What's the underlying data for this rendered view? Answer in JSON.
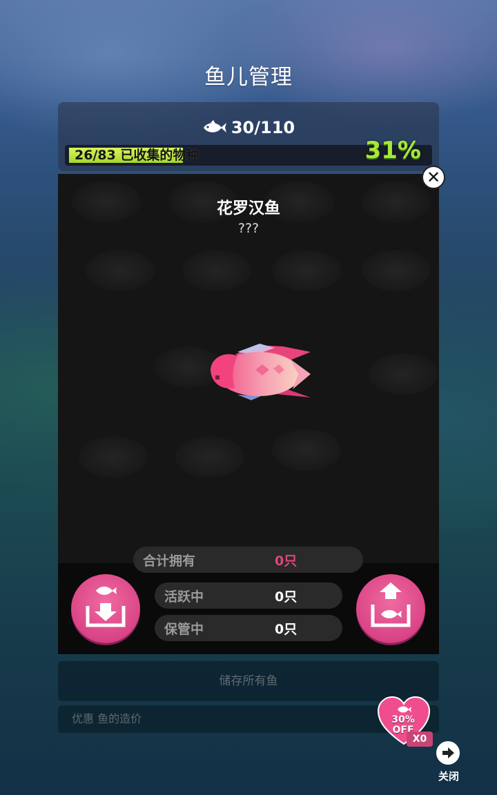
{
  "screen": {
    "title": "鱼儿管理"
  },
  "header": {
    "fish_count": "30/110",
    "collection_text": "26/83 已收集的物种",
    "collection_fraction": 0.31,
    "percent": "31%"
  },
  "detail": {
    "fish_name": "花罗汉鱼",
    "fish_subtitle": "???"
  },
  "stats": {
    "total_label": "合计拥有",
    "total_value": "0只",
    "active_label": "活跃中",
    "active_value": "0只",
    "stored_label": "保管中",
    "stored_value": "0只"
  },
  "actions": {
    "store_all": "储存所有鱼",
    "offer_text": "优惠 鱼的造价",
    "discount_line1": "30%",
    "discount_line2": "OFF",
    "discount_count": "X0",
    "exit_label": "关闭"
  },
  "colors": {
    "accent_pink": "#d94486",
    "progress_green": "#a6d62d",
    "percent_green": "#a6e83a",
    "value_pink": "#e0457f"
  },
  "icons": [
    "fish-icon",
    "close-icon",
    "store-fish-icon",
    "release-fish-icon",
    "heart-badge-icon",
    "exit-arrow-icon"
  ]
}
